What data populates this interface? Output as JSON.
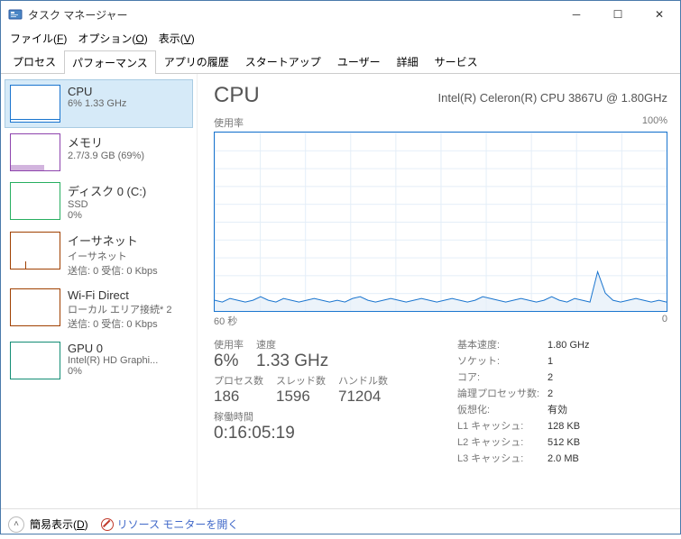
{
  "window": {
    "title": "タスク マネージャー"
  },
  "menubar": {
    "file": "ファイル(F)",
    "options": "オプション(O)",
    "view": "表示(V)"
  },
  "tabs": [
    "プロセス",
    "パフォーマンス",
    "アプリの履歴",
    "スタートアップ",
    "ユーザー",
    "詳細",
    "サービス"
  ],
  "active_tab": 1,
  "sidebar": [
    {
      "name": "CPU",
      "sub": "6%  1.33 GHz",
      "kind": "cpu",
      "selected": true
    },
    {
      "name": "メモリ",
      "sub": "2.7/3.9 GB (69%)",
      "kind": "mem"
    },
    {
      "name": "ディスク 0 (C:)",
      "sub": "SSD\n0%",
      "kind": "disk"
    },
    {
      "name": "イーサネット",
      "sub": "イーサネット\n送信: 0 受信: 0 Kbps",
      "kind": "eth"
    },
    {
      "name": "Wi-Fi Direct",
      "sub": "ローカル エリア接続* 2\n送信: 0 受信: 0 Kbps",
      "kind": "wifi"
    },
    {
      "name": "GPU 0",
      "sub": "Intel(R) HD Graphi...\n0%",
      "kind": "gpu"
    }
  ],
  "main": {
    "title": "CPU",
    "cpu_name": "Intel(R) Celeron(R) CPU 3867U @ 1.80GHz",
    "chart_top_left": "使用率",
    "chart_top_right": "100%",
    "chart_bottom_left": "60 秒",
    "chart_bottom_right": "0",
    "stats": {
      "usage_lbl": "使用率",
      "usage_val": "6%",
      "speed_lbl": "速度",
      "speed_val": "1.33 GHz",
      "proc_lbl": "プロセス数",
      "proc_val": "186",
      "thread_lbl": "スレッド数",
      "thread_val": "1596",
      "handle_lbl": "ハンドル数",
      "handle_val": "71204",
      "uptime_lbl": "稼働時間",
      "uptime_val": "0:16:05:19"
    },
    "right": [
      {
        "k": "基本速度:",
        "v": "1.80 GHz"
      },
      {
        "k": "ソケット:",
        "v": "1"
      },
      {
        "k": "コア:",
        "v": "2"
      },
      {
        "k": "論理プロセッサ数:",
        "v": "2"
      },
      {
        "k": "仮想化:",
        "v": "有効"
      },
      {
        "k": "L1 キャッシュ:",
        "v": "128 KB"
      },
      {
        "k": "L2 キャッシュ:",
        "v": "512 KB"
      },
      {
        "k": "L3 キャッシュ:",
        "v": "2.0 MB"
      }
    ]
  },
  "footer": {
    "fewer": "簡易表示(D)",
    "resmon": "リソース モニターを開く"
  },
  "chart_data": {
    "type": "line",
    "title": "CPU 使用率",
    "xlabel": "60 秒",
    "ylabel": "使用率",
    "ylim": [
      0,
      100
    ],
    "x_range_seconds": 60,
    "values_pct": [
      6,
      5,
      7,
      6,
      5,
      6,
      8,
      6,
      5,
      7,
      6,
      5,
      6,
      7,
      6,
      5,
      6,
      5,
      7,
      8,
      6,
      5,
      6,
      7,
      6,
      5,
      6,
      7,
      6,
      5,
      6,
      7,
      6,
      5,
      6,
      8,
      7,
      6,
      5,
      6,
      7,
      6,
      5,
      6,
      8,
      6,
      5,
      7,
      6,
      5,
      22,
      10,
      6,
      5,
      6,
      7,
      6,
      5,
      6,
      5
    ]
  }
}
